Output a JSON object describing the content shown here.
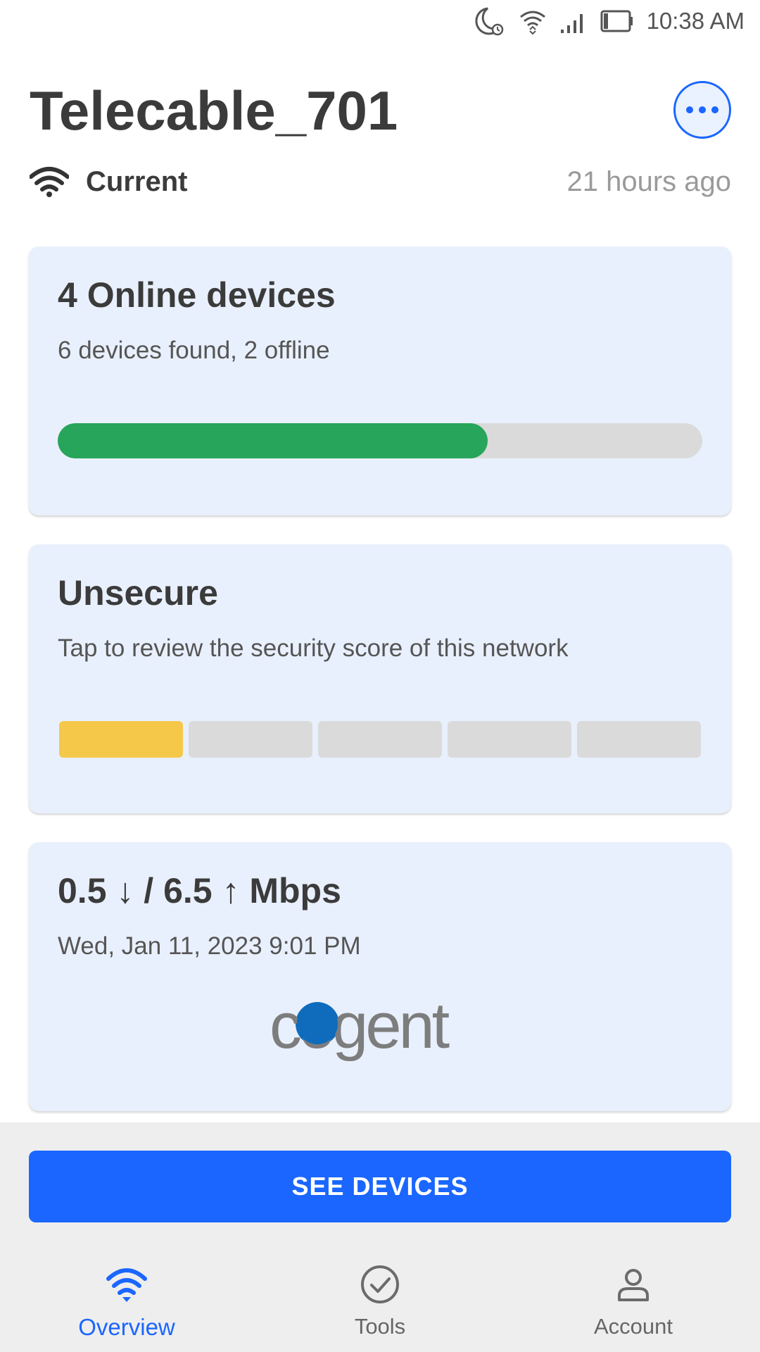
{
  "status_bar": {
    "time": "10:38 AM",
    "icons": [
      "moon-alarm-icon",
      "wifi-icon",
      "signal-icon",
      "battery-icon"
    ]
  },
  "header": {
    "network_name": "Telecable_701",
    "more_icon": "more-horizontal-icon",
    "status_label": "Current",
    "last_seen": "21 hours ago"
  },
  "devices_card": {
    "title": "4 Online devices",
    "subtitle": "6 devices found, 2 offline",
    "online": 4,
    "total": 6,
    "progress_fraction": 0.667,
    "progress_color": "#27a55a"
  },
  "security_card": {
    "title": "Unsecure",
    "subtitle": "Tap to review the security score of this network",
    "score_segments_filled": 1,
    "score_segments_total": 5,
    "filled_color": "#f6c84a",
    "empty_color": "#dadada"
  },
  "speed_card": {
    "title": "0.5 ↓ / 6.5 ↑ Mbps",
    "subtitle": "Wed, Jan 11, 2023 9:01 PM",
    "provider_logo_text": "cogent"
  },
  "actions": {
    "see_devices_label": "SEE DEVICES"
  },
  "bottom_nav": {
    "items": [
      {
        "label": "Overview",
        "icon": "wifi-icon",
        "active": true
      },
      {
        "label": "Tools",
        "icon": "check-circle-icon",
        "active": false
      },
      {
        "label": "Account",
        "icon": "person-icon",
        "active": false
      }
    ]
  },
  "colors": {
    "accent": "#1a66ff",
    "card_background": "#e9f0fd",
    "nav_background": "#eeeeee"
  }
}
